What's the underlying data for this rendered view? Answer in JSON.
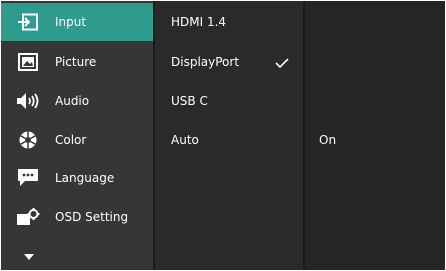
{
  "colors": {
    "accent": "#2e9b8d",
    "menu_bg": "#363636",
    "submenu_bg": "#2a2a2a",
    "value_bg": "#252525",
    "text": "#ffffff"
  },
  "main_menu": {
    "items": [
      {
        "label": "Input",
        "icon": "input-icon",
        "active": true
      },
      {
        "label": "Picture",
        "icon": "picture-icon",
        "active": false
      },
      {
        "label": "Audio",
        "icon": "speaker-icon",
        "active": false
      },
      {
        "label": "Color",
        "icon": "color-wheel-icon",
        "active": false
      },
      {
        "label": "Language",
        "icon": "speech-bubble-icon",
        "active": false
      },
      {
        "label": "OSD Setting",
        "icon": "osd-settings-icon",
        "active": false
      }
    ],
    "more_icon": "chevron-down-icon"
  },
  "sub_menu": {
    "items": [
      {
        "label": "HDMI 1.4",
        "checked": false
      },
      {
        "label": "DisplayPort",
        "checked": true
      },
      {
        "label": "USB C",
        "checked": false
      },
      {
        "label": "Auto",
        "checked": false
      }
    ]
  },
  "value_column": {
    "value": "On"
  }
}
